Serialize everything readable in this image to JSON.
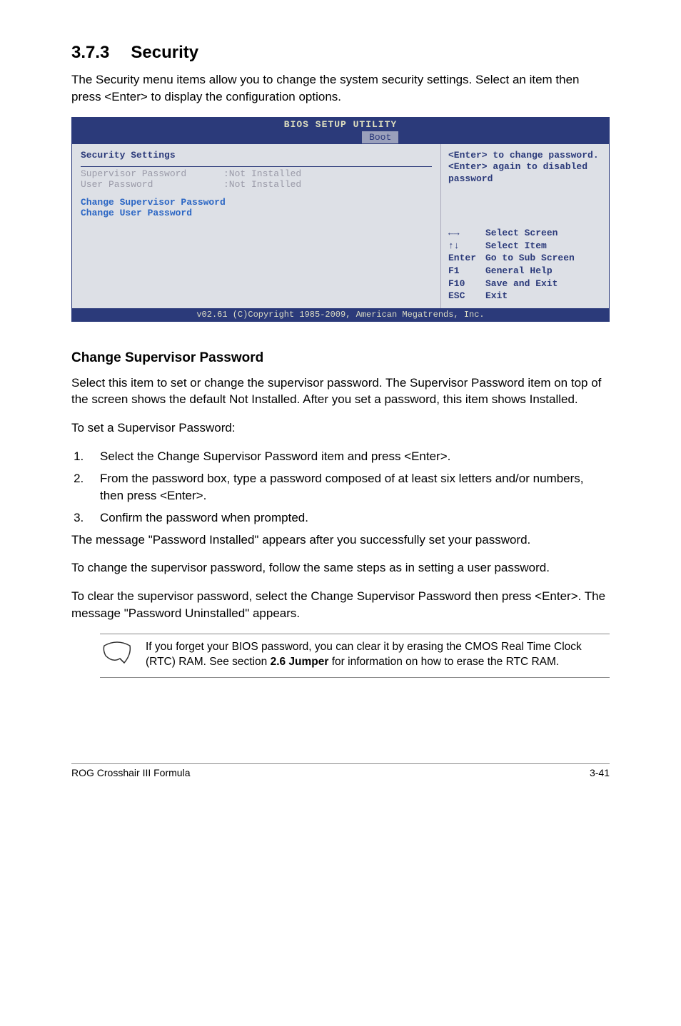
{
  "heading_number": "3.7.3",
  "heading_title": "Security",
  "intro": "The Security menu items allow you to change the system security settings. Select an item then press <Enter> to display the configuration options.",
  "bios": {
    "title": "BIOS SETUP UTILITY",
    "tab": "Boot",
    "main_heading": "Security Settings",
    "rows": [
      {
        "label": "Supervisor Password",
        "value": ":Not Installed"
      },
      {
        "label": "User Password",
        "value": ":Not Installed"
      }
    ],
    "actions": [
      "Change Supervisor Password",
      "Change User Password"
    ],
    "help": "<Enter> to change password.\n<Enter> again to disabled password",
    "legend": [
      {
        "key": "←→",
        "desc": "Select Screen"
      },
      {
        "key": "↑↓",
        "desc": "Select Item"
      },
      {
        "key": "Enter",
        "desc": "Go to Sub Screen"
      },
      {
        "key": "F1",
        "desc": "General Help"
      },
      {
        "key": "F10",
        "desc": "Save and Exit"
      },
      {
        "key": "ESC",
        "desc": "Exit"
      }
    ],
    "footer": "v02.61 (C)Copyright 1985-2009, American Megatrends, Inc."
  },
  "subheading": "Change Supervisor Password",
  "para1": "Select this item to set or change the supervisor password. The Supervisor Password item on top of the screen shows the default Not Installed. After you set a password, this item shows Installed.",
  "para2": "To set a Supervisor Password:",
  "steps": [
    "Select the Change Supervisor Password item and press <Enter>.",
    "From the password box, type a password composed of at least six letters and/or numbers, then press <Enter>.",
    "Confirm the password when prompted."
  ],
  "para3": "The message \"Password Installed\" appears after you successfully set your password.",
  "para4": "To change the supervisor password, follow the same steps as in setting a user password.",
  "para5": "To clear the supervisor password, select the Change Supervisor Password then press <Enter>. The message \"Password Uninstalled\" appears.",
  "note_pre": "If you forget your BIOS password, you can clear it by erasing the CMOS Real Time Clock (RTC) RAM. See section ",
  "note_bold": "2.6 Jumper",
  "note_post": " for information on how to erase the RTC RAM.",
  "footer_left": "ROG Crosshair III Formula",
  "footer_right": "3-41"
}
